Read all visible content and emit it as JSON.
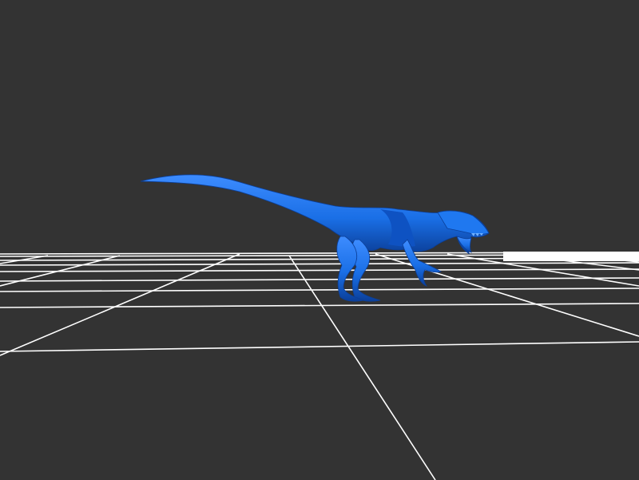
{
  "viewer": {
    "background_color": "#333333",
    "grid_color": "#ffffff",
    "model_color": "#1a6fe6",
    "model_shadow_color": "#0b3f99",
    "model_highlight_color": "#3d8cff",
    "model_name": "raptor-model"
  }
}
